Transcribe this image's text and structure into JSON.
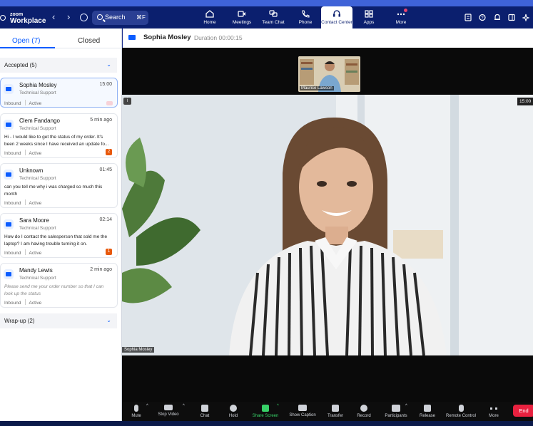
{
  "app": {
    "brand_top": "zoom",
    "brand_bottom": "Workplace"
  },
  "topbar": {
    "search_label": "Search",
    "search_shortcut": "⌘F",
    "tabs": [
      {
        "label": "Home",
        "icon": "home-icon"
      },
      {
        "label": "Meetings",
        "icon": "video-camera-icon"
      },
      {
        "label": "Team Chat",
        "icon": "chat-icon"
      },
      {
        "label": "Phone",
        "icon": "phone-icon"
      },
      {
        "label": "Contact Center",
        "icon": "headset-icon",
        "active": true
      },
      {
        "label": "Apps",
        "icon": "apps-icon"
      },
      {
        "label": "More",
        "icon": "more-icon",
        "notification": true
      }
    ],
    "right_icons": [
      "contacts-icon",
      "help-icon",
      "bell-icon",
      "panel-icon",
      "sparkle-icon"
    ]
  },
  "queue": {
    "tab_open": "Open (7)",
    "tab_closed": "Closed",
    "accepted_label": "Accepted (5)",
    "wrapup_label": "Wrap-up (2)",
    "items": [
      {
        "name": "Sophia Mosley",
        "time": "15:00",
        "team": "Technical Support",
        "message": "",
        "direction": "Inbound",
        "status": "Active",
        "channel": "video-icon"
      },
      {
        "name": "Clem Fandango",
        "time": "5 min ago",
        "team": "Technical Support",
        "message": "Hi - I would like to get the status of my order. It's been 2 weeks since I have received an update fo...",
        "direction": "Inbound",
        "status": "Active",
        "badge": "2",
        "channel": "chat-bubble-icon"
      },
      {
        "name": "Unknown",
        "time": "01:45",
        "team": "Technical Support",
        "message": "can you tell me why i was charged so much this month",
        "direction": "Inbound",
        "status": "Active",
        "channel": "chat-bubble-icon"
      },
      {
        "name": "Sara Moore",
        "time": "02:14",
        "team": "Technical Support",
        "message": "How do I contact the salesperson that sold me the laptop? I am having trouble turning it on.",
        "direction": "Inbound",
        "status": "Active",
        "badge": "1",
        "channel": "email-icon"
      },
      {
        "name": "Mandy Lewis",
        "time": "2 min ago",
        "team": "Technical Support",
        "message": "Please send me your order number so that I can look up the status",
        "direction": "Inbound",
        "status": "Active",
        "channel": "chat-bubble-icon"
      }
    ]
  },
  "call": {
    "name": "Sophia Mosley",
    "duration": "Duration 00:00:15",
    "thumb_name": "Maurice Lawson",
    "main_name": "Sophia Mosley",
    "timer": "15:00"
  },
  "toolbar": {
    "buttons": [
      {
        "label": "Mute",
        "icon": "microphone-icon"
      },
      {
        "label": "Stop Video",
        "icon": "video-camera-icon"
      },
      {
        "label": "Chat",
        "icon": "chat-icon"
      },
      {
        "label": "Hold",
        "icon": "hold-icon"
      },
      {
        "label": "Share Screen",
        "icon": "share-screen-icon"
      },
      {
        "label": "Show Caption",
        "icon": "caption-icon"
      },
      {
        "label": "Transfer",
        "icon": "transfer-icon"
      },
      {
        "label": "Record",
        "icon": "record-icon"
      },
      {
        "label": "Participants",
        "icon": "participants-icon",
        "count": "2"
      },
      {
        "label": "Release",
        "icon": "release-icon"
      },
      {
        "label": "Remote Control",
        "icon": "mouse-icon"
      },
      {
        "label": "More",
        "icon": "more-icon"
      }
    ],
    "end_label": "End"
  }
}
